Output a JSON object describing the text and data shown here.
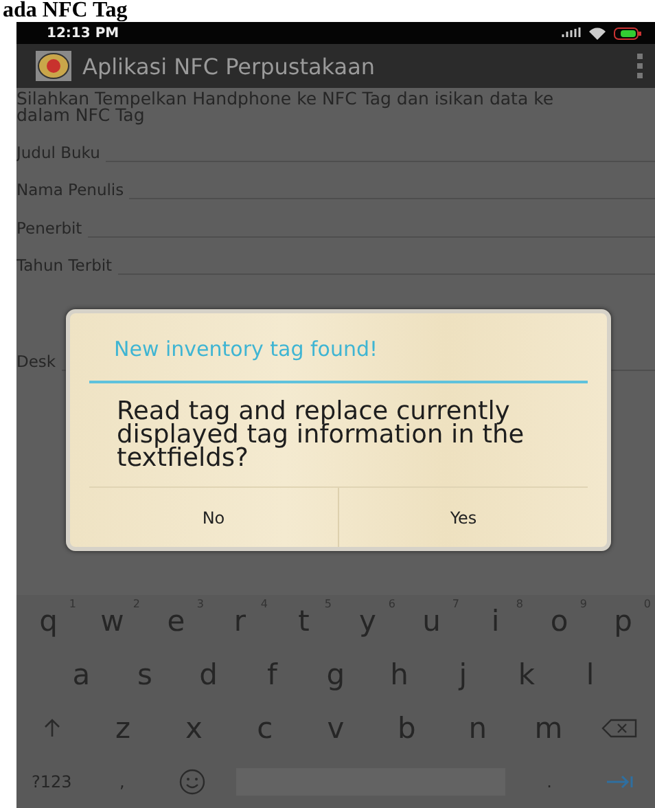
{
  "caption": "ada NFC Tag",
  "status_bar": {
    "time": "12:13 PM"
  },
  "action_bar": {
    "title": "Aplikasi NFC Perpustakaan"
  },
  "instruction": "Silahkan Tempelkan Handphone ke NFC Tag dan isikan data ke dalam NFC Tag",
  "fields": [
    {
      "label": "Judul Buku"
    },
    {
      "label": "Nama Penulis"
    },
    {
      "label": "Penerbit"
    },
    {
      "label": "Tahun Terbit"
    },
    {
      "label": "Desk"
    }
  ],
  "dialog": {
    "title": "New inventory tag found!",
    "message": "Read tag and replace currently displayed tag information in the textfields?",
    "buttons": [
      "No",
      "Yes"
    ]
  },
  "keyboard": {
    "rows": [
      [
        {
          "kind": "char",
          "key": "q",
          "hint": "1"
        },
        {
          "kind": "char",
          "key": "w",
          "hint": "2"
        },
        {
          "kind": "char",
          "key": "e",
          "hint": "3"
        },
        {
          "kind": "char",
          "key": "r",
          "hint": "4"
        },
        {
          "kind": "char",
          "key": "t",
          "hint": "5"
        },
        {
          "kind": "char",
          "key": "y",
          "hint": "6"
        },
        {
          "kind": "char",
          "key": "u",
          "hint": "7"
        },
        {
          "kind": "char",
          "key": "i",
          "hint": "8"
        },
        {
          "kind": "char",
          "key": "o",
          "hint": "9"
        },
        {
          "kind": "char",
          "key": "p",
          "hint": "0"
        }
      ],
      [
        {
          "kind": "char",
          "key": "a"
        },
        {
          "kind": "char",
          "key": "s"
        },
        {
          "kind": "char",
          "key": "d"
        },
        {
          "kind": "char",
          "key": "f"
        },
        {
          "kind": "char",
          "key": "g"
        },
        {
          "kind": "char",
          "key": "h"
        },
        {
          "kind": "char",
          "key": "j"
        },
        {
          "kind": "char",
          "key": "k"
        },
        {
          "kind": "char",
          "key": "l"
        }
      ],
      [
        {
          "kind": "shift"
        },
        {
          "kind": "char",
          "key": "z"
        },
        {
          "kind": "char",
          "key": "x"
        },
        {
          "kind": "char",
          "key": "c"
        },
        {
          "kind": "char",
          "key": "v"
        },
        {
          "kind": "char",
          "key": "b"
        },
        {
          "kind": "char",
          "key": "n"
        },
        {
          "kind": "char",
          "key": "m"
        },
        {
          "kind": "backspace"
        }
      ],
      [
        {
          "kind": "char",
          "key": "?123"
        },
        {
          "kind": "char",
          "key": ","
        },
        {
          "kind": "emoji"
        },
        {
          "kind": "space"
        },
        {
          "kind": "char",
          "key": "."
        },
        {
          "kind": "enter"
        }
      ]
    ]
  }
}
